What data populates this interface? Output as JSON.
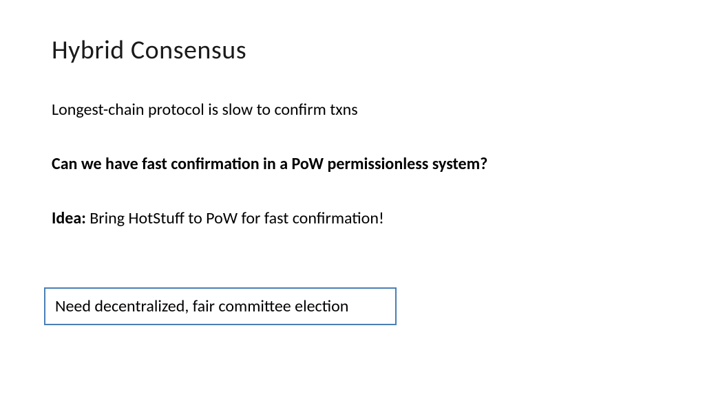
{
  "title": "Hybrid Consensus",
  "line1": "Longest-chain protocol is slow to confirm txns",
  "line2": "Can we have fast confirmation in a PoW permissionless system?",
  "idea_label": "Idea:",
  "idea_text": " Bring HotStuff to PoW for fast confirmation!",
  "boxed": "Need decentralized, fair committee election"
}
